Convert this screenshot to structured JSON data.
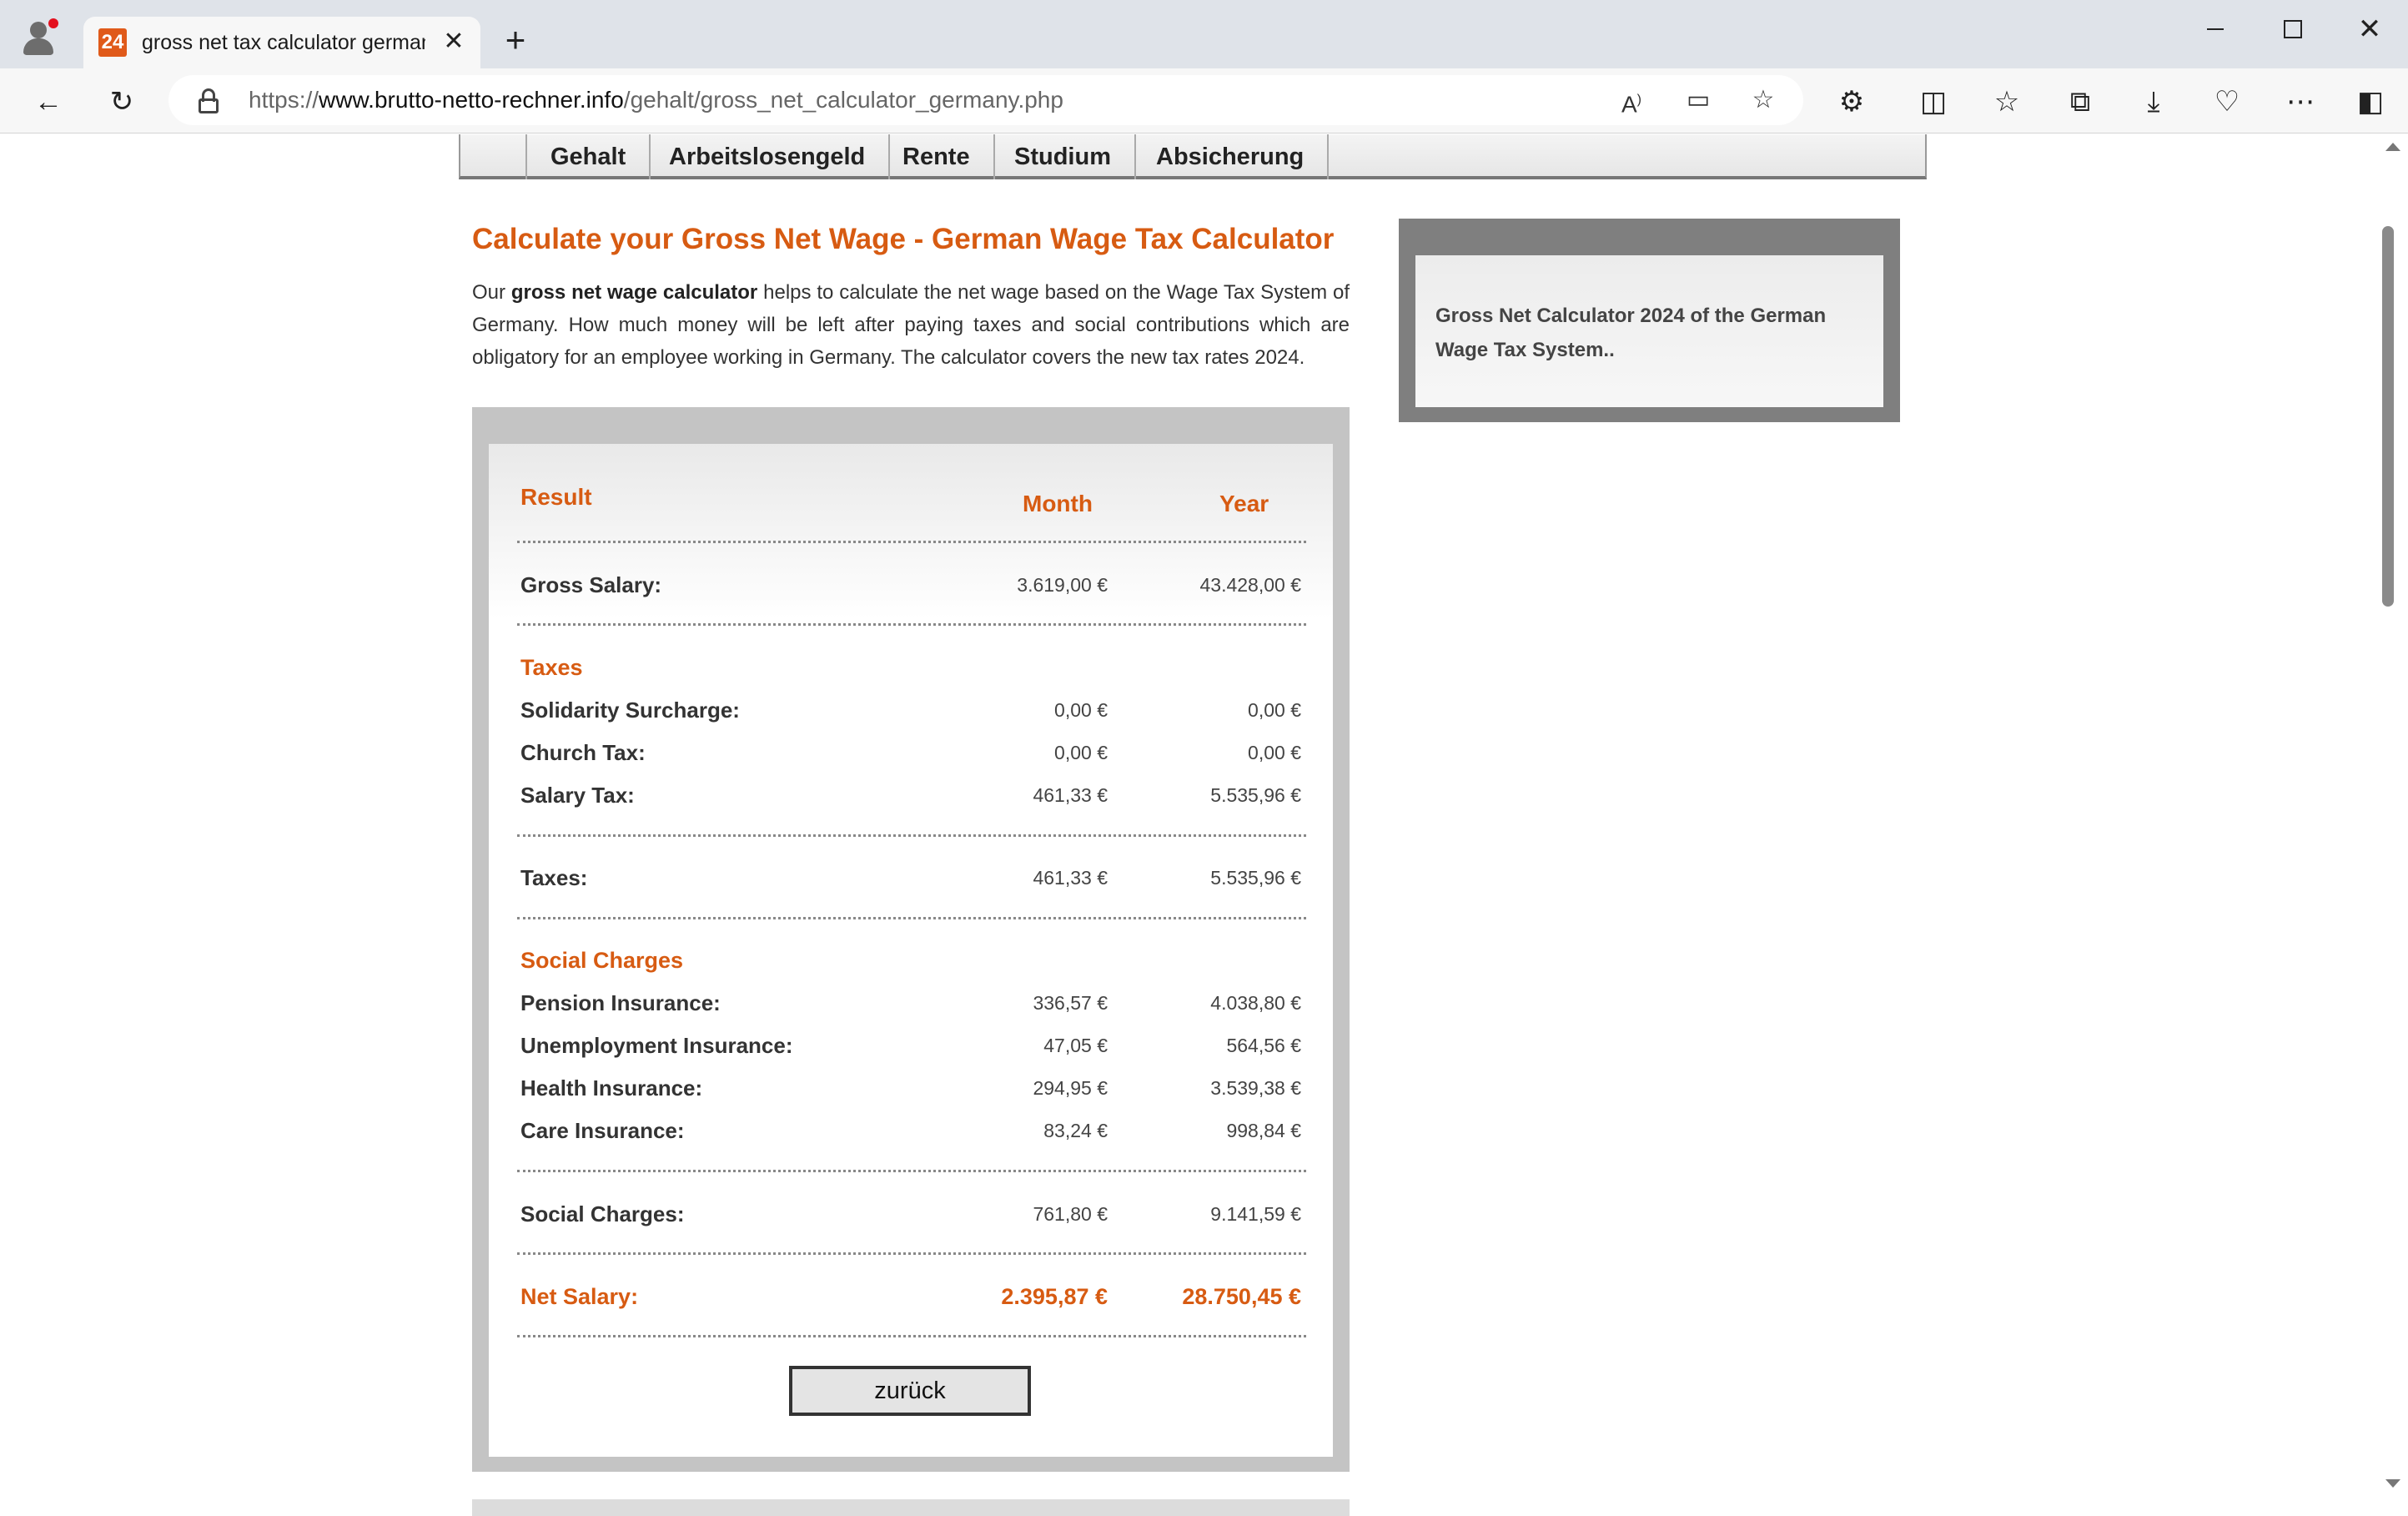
{
  "browser": {
    "tab_favicon": "24",
    "tab_title": "gross net tax calculator germany",
    "url_scheme": "https://",
    "url_host": "www.brutto-netto-rechner.info",
    "url_path": "/gehalt/gross_net_calculator_germany.php"
  },
  "nav": {
    "items": [
      "Gehalt",
      "Arbeitslosengeld",
      "Rente",
      "Studium",
      "Absicherung"
    ]
  },
  "main": {
    "headline": "Calculate your Gross Net Wage - German Wage Tax Calculator",
    "intro_prefix": "Our ",
    "intro_bold": "gross net wage calculator",
    "intro_rest": " helps to calculate the net wage based on the Wage Tax System of Germany. How much money will be left after paying taxes and social contributions which are obligatory for an employee working in Germany. The calculator covers the new tax rates 2024."
  },
  "result": {
    "title": "Result",
    "col_month": "Month",
    "col_year": "Year",
    "gross": {
      "label": "Gross Salary:",
      "month": "3.619,00 €",
      "year": "43.428,00 €"
    },
    "taxes_heading": "Taxes",
    "solidarity": {
      "label": "Solidarity Surcharge:",
      "month": "0,00 €",
      "year": "0,00 €"
    },
    "church": {
      "label": "Church Tax:",
      "month": "0,00 €",
      "year": "0,00 €"
    },
    "salary_tax": {
      "label": "Salary Tax:",
      "month": "461,33 €",
      "year": "5.535,96 €"
    },
    "taxes_total": {
      "label": "Taxes:",
      "month": "461,33 €",
      "year": "5.535,96 €"
    },
    "social_heading": "Social Charges",
    "pension": {
      "label": "Pension Insurance:",
      "month": "336,57 €",
      "year": "4.038,80 €"
    },
    "unemployment": {
      "label": "Unemployment Insurance:",
      "month": "47,05 €",
      "year": "564,56 €"
    },
    "health": {
      "label": "Health Insurance:",
      "month": "294,95 €",
      "year": "3.539,38 €"
    },
    "care": {
      "label": "Care Insurance:",
      "month": "83,24 €",
      "year": "998,84 €"
    },
    "social_total": {
      "label": "Social Charges:",
      "month": "761,80 €",
      "year": "9.141,59 €"
    },
    "net": {
      "label": "Net Salary:",
      "month": "2.395,87 €",
      "year": "28.750,45 €"
    },
    "back_label": "zurück"
  },
  "sidebar": {
    "text": "Gross Net Calculator 2024 of the German Wage Tax System.."
  },
  "colors": {
    "accent": "#d75b12",
    "frame_gray": "#c4c4c4",
    "sidebar_gray": "#7f7f7f"
  }
}
